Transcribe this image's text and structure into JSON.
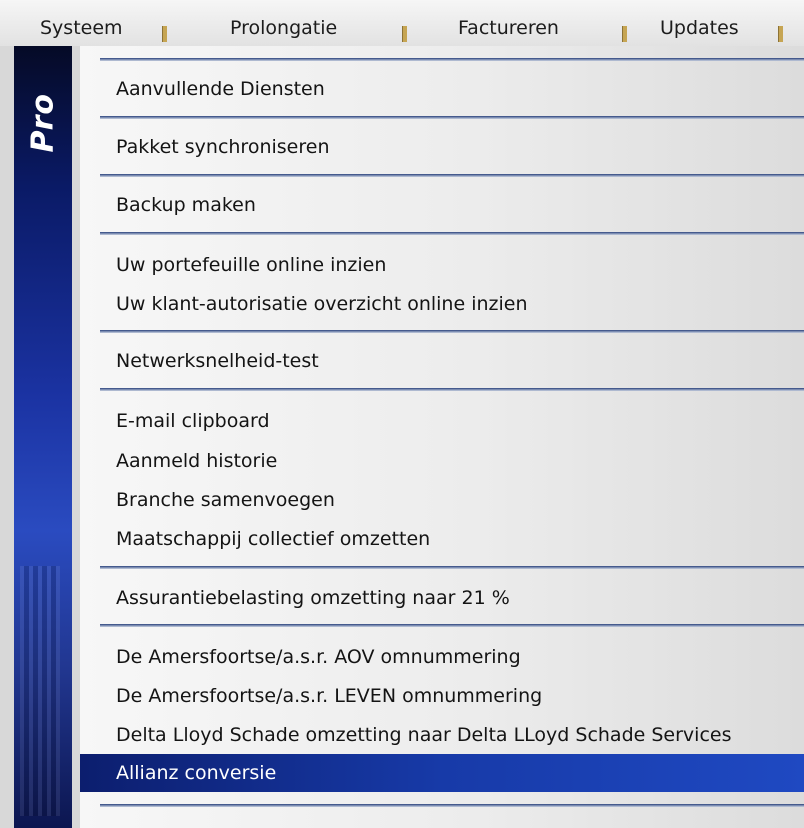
{
  "menubar": {
    "items": [
      "Systeem",
      "Prolongatie",
      "Factureren",
      "Updates"
    ]
  },
  "sidebar": {
    "logo_text": "Pro"
  },
  "menu": {
    "items": [
      "Aanvullende Diensten",
      "Pakket synchroniseren",
      "Backup maken",
      "Uw portefeuille online inzien",
      "Uw klant-autorisatie overzicht online inzien",
      "Netwerksnelheid-test",
      "E-mail clipboard",
      "Aanmeld historie",
      "Branche samenvoegen",
      "Maatschappij collectief omzetten",
      "Assurantiebelasting omzetting naar 21 %",
      "De Amersfoortse/a.s.r. AOV omnummering",
      "De Amersfoortse/a.s.r. LEVEN omnummering",
      "Delta Lloyd Schade omzetting naar Delta LLoyd Schade Services",
      "Allianz conversie"
    ],
    "selected": "Allianz conversie"
  }
}
